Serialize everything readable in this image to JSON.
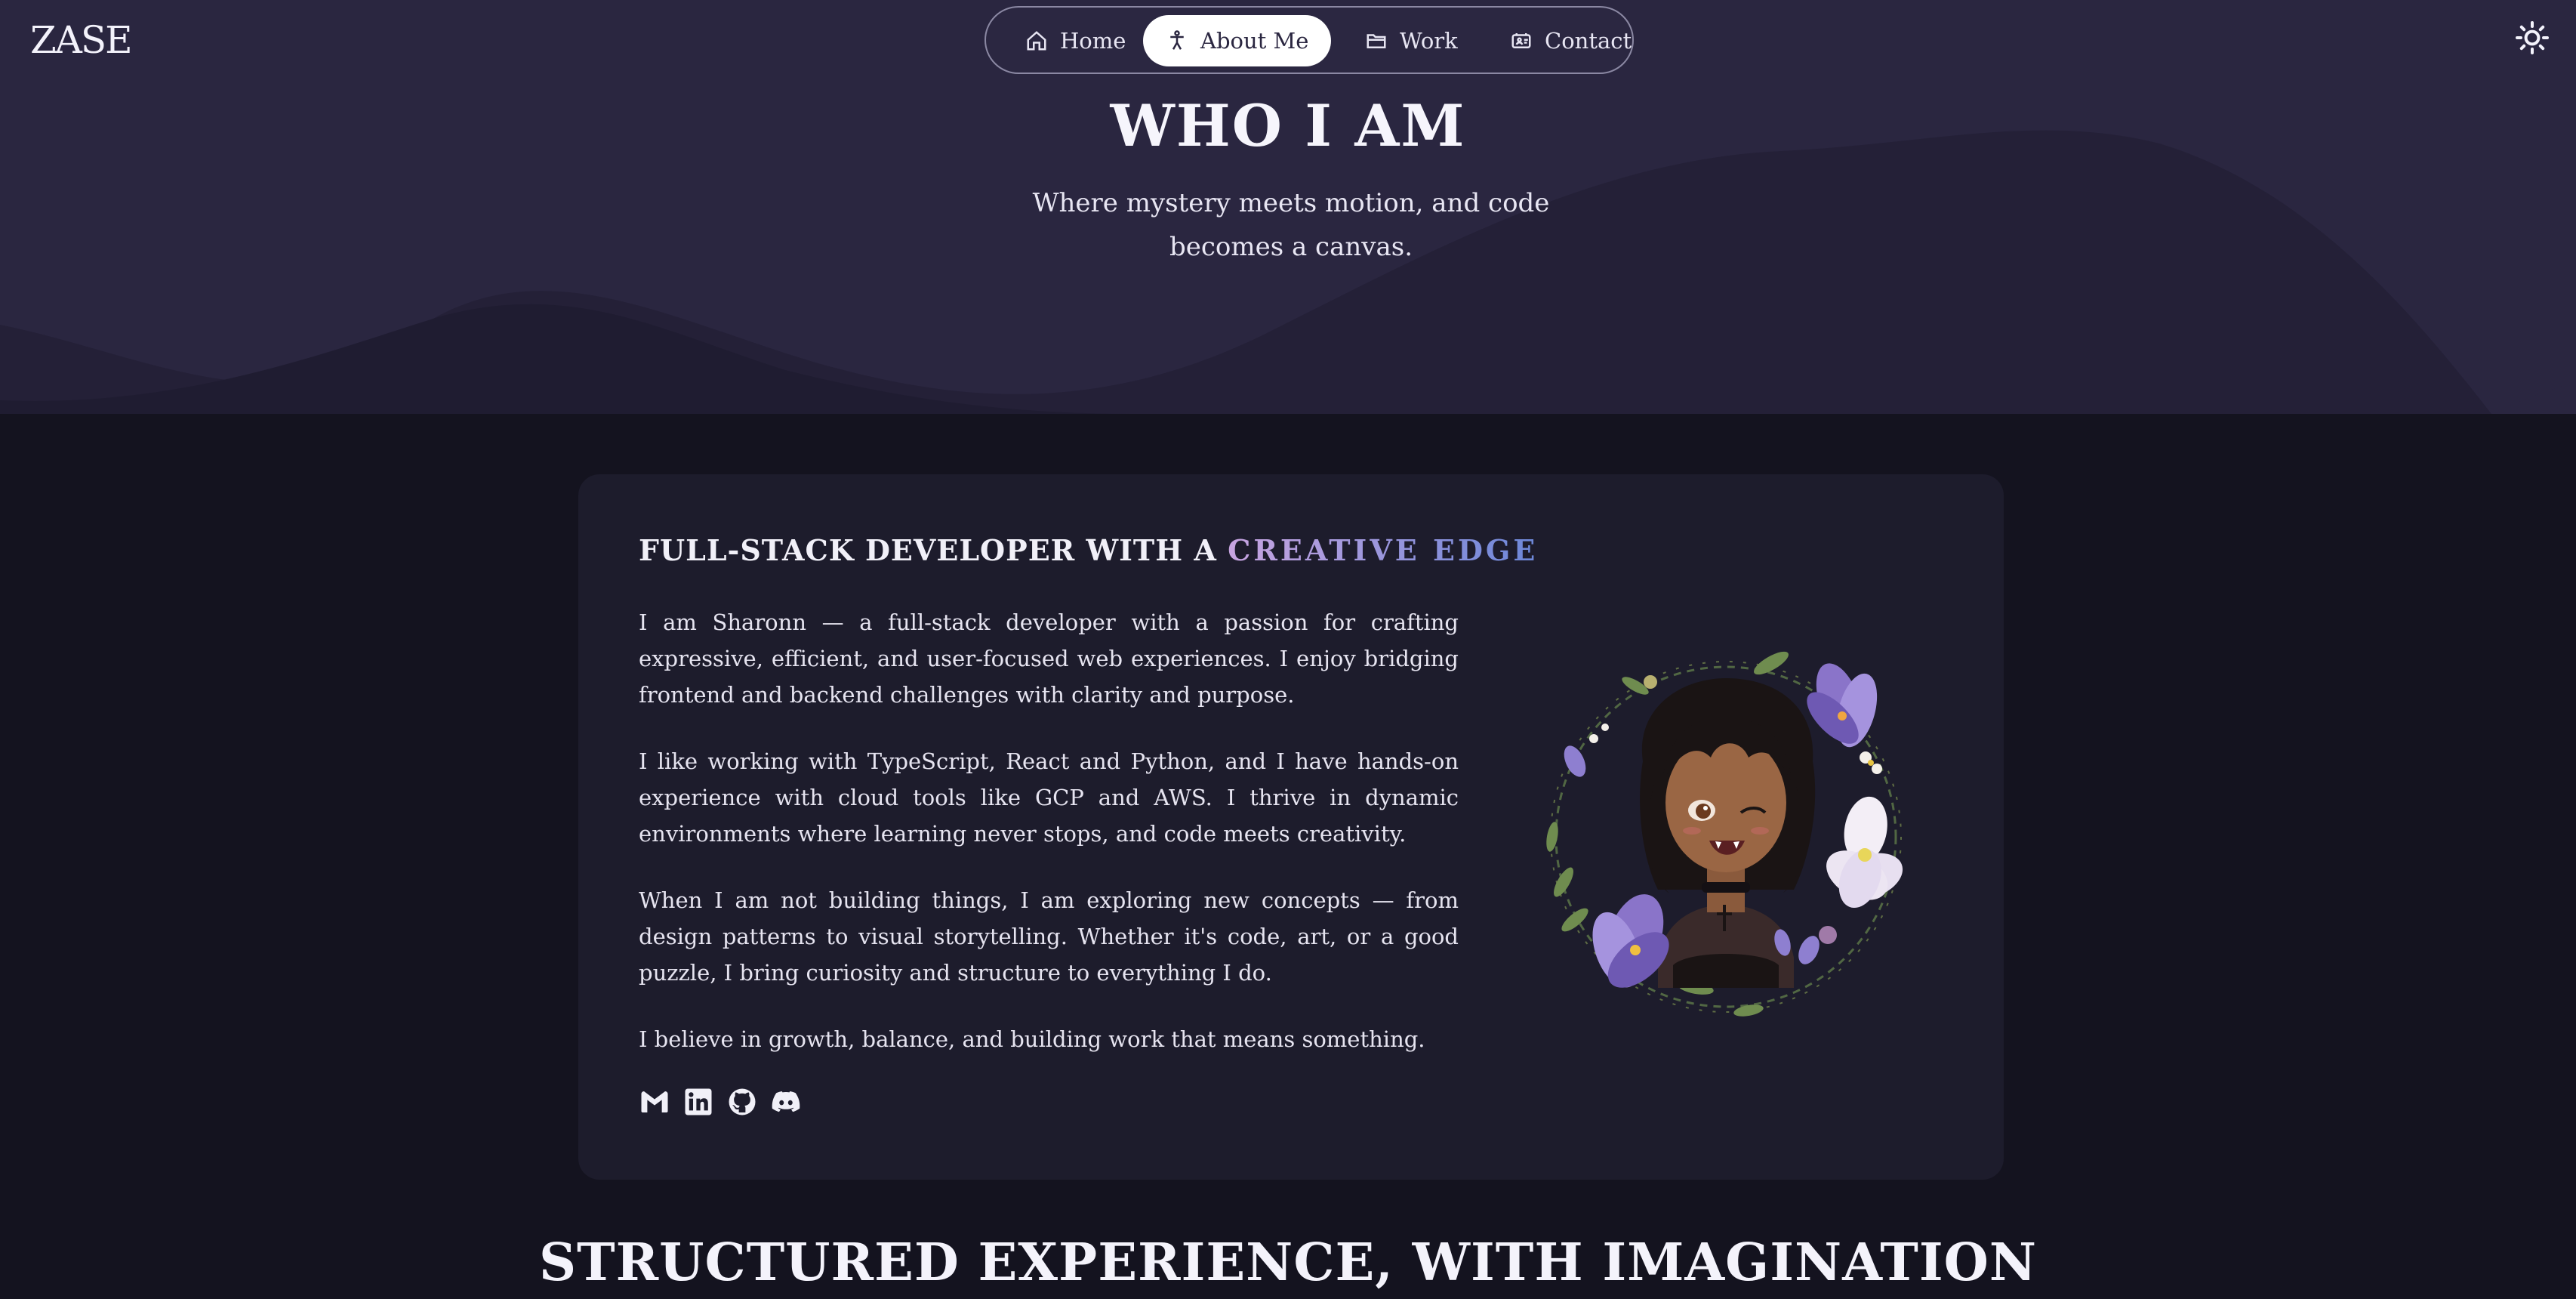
{
  "brand": {
    "logo_text": "ZASE"
  },
  "nav": {
    "items": [
      {
        "label": "Home",
        "icon": "home-icon"
      },
      {
        "label": "About Me",
        "icon": "person-icon",
        "active": true
      },
      {
        "label": "Work",
        "icon": "folder-icon"
      },
      {
        "label": "Contact",
        "icon": "contact-card-icon"
      }
    ]
  },
  "theme_toggle": {
    "icon": "sun-icon"
  },
  "hero": {
    "title": "WHO I AM",
    "subtitle": "Where mystery meets motion, and code becomes a canvas."
  },
  "about": {
    "heading_prefix": "FULL-STACK DEVELOPER WITH A",
    "heading_accent": "CREATIVE EDGE",
    "paragraphs": [
      "I am Sharonn — a full-stack developer with a passion for crafting expressive, efficient, and user-focused web experiences. I enjoy bridging frontend and backend challenges with clarity and purpose.",
      "I like working with TypeScript, React and Python, and I have hands-on experience with cloud tools like GCP and AWS. I thrive in dynamic environments where learning never stops, and code meets creativity.",
      "When I am not building things, I am exploring new concepts — from design patterns to visual storytelling. Whether it's code, art, or a good puzzle, I bring curiosity and structure to everything I do.",
      "I believe in growth, balance, and building work that means something."
    ],
    "socials": [
      "gmail-icon",
      "linkedin-icon",
      "github-icon",
      "discord-icon"
    ]
  },
  "experience": {
    "title": "STRUCTURED EXPERIENCE, WITH IMAGINATION"
  },
  "colors": {
    "hero_bg": "#2a2640",
    "page_bg": "#14131f",
    "card_bg": "#1d1c2c",
    "accent_start": "#c7a4e0",
    "accent_end": "#6c87d8"
  }
}
